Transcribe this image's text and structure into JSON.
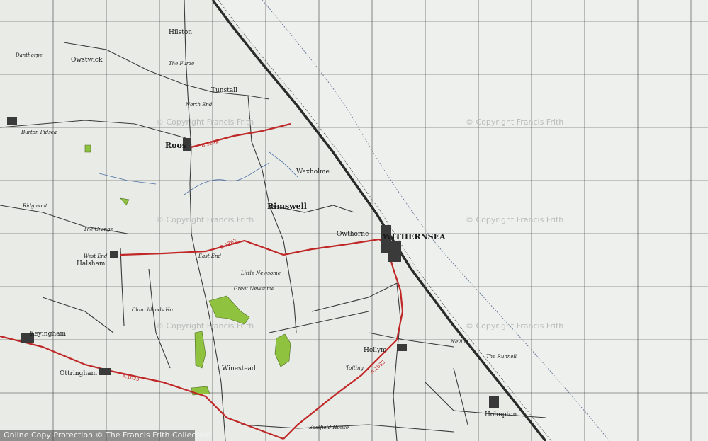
{
  "map": {
    "colors": {
      "land": "#e9ebe7",
      "grid": "#3d3d3d",
      "road_a": "#c02828",
      "road_b": "#c02828",
      "woodland": "#8fc23f",
      "coast": "#2b2b2b",
      "watermark": "#b9bcb8"
    },
    "watermark": "© Copyright Francis Frith",
    "road_numbers": {
      "b1242": "B.1242",
      "b1362": "B.1362",
      "a1033": "A.1033"
    },
    "places": {
      "withernsea": "WITHERNSEA",
      "roos": "Roos",
      "hilston": "Hilston",
      "owstwick": "Owstwick",
      "tunstall": "Tunstall",
      "rimswell": "Rimswell",
      "waxholme": "Waxholme",
      "owthorne": "Owthorne",
      "halsham": "Halsham",
      "west_end": "West End",
      "keyingham": "Keyingham",
      "ottringham": "Ottringham",
      "winestead": "Winestead",
      "hollym": "Hollym",
      "holmpton": "Holmpton",
      "east_end": "East End",
      "burton_pidsea": "Burton Pidsea",
      "north_end": "North End",
      "the_grange": "The Grange",
      "great_newsome": "Great Newsome",
      "little_newsome": "Little Newsome",
      "the_furze": "The Furze",
      "dent_hall": "Danthorpe",
      "ridgmont": "Ridgmont",
      "churchlands": "Churchlands Ho.",
      "eastfield": "Eastfield House",
      "tofting": "Tofting",
      "nevills": "Nevills",
      "the_runnell": "The Runnell"
    },
    "footer": "Online Copy Protection © The Francis Frith Collection"
  }
}
